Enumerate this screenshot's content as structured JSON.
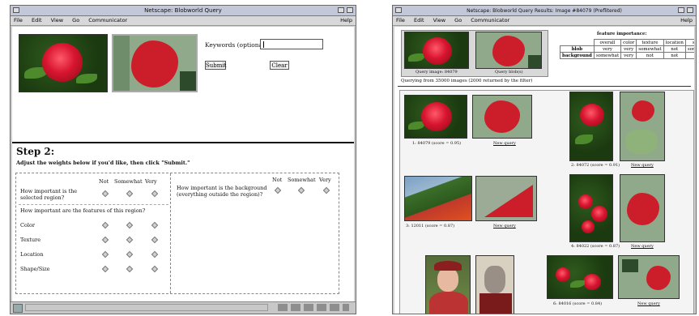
{
  "left_window": {
    "title": "Netscape: Blobworld Query",
    "menu": [
      "File",
      "Edit",
      "View",
      "Go",
      "Communicator"
    ],
    "help": "Help",
    "keywords_label": "Keywords (optional):",
    "keywords_value": "",
    "submit_label": "Submit",
    "clear_label": "Clear",
    "step_title": "Step 2:",
    "instructions": "Adjust the weights below if you'd like, then click \"Submit.\"",
    "col_not": "Not",
    "col_somewhat": "Somewhat",
    "col_very": "Very",
    "q_region_1": "How important is the",
    "q_region_2": "selected region?",
    "q_features": "How important are the features of this region?",
    "features": [
      "Color",
      "Texture",
      "Location",
      "Shape/Size"
    ],
    "q_background_1": "How important is the background",
    "q_background_2": "(everything outside the region)?"
  },
  "right_window": {
    "title": "Netscape: Blobworld Query Results: Image #84079 (Preflitered)",
    "menu": [
      "File",
      "Edit",
      "View",
      "Go",
      "Communicator"
    ],
    "help": "Help",
    "query_image_caption": "Query image: 84079",
    "query_blobs_caption": "Query blob(s)",
    "importance_header": "feature importance:",
    "importance_cols": [
      "overall",
      "color",
      "texture",
      "location",
      "shape"
    ],
    "importance_rows": [
      {
        "label": "blob",
        "values": [
          "very",
          "very",
          "somewhat",
          "not",
          "somewhat"
        ]
      },
      {
        "label": "background",
        "values": [
          "somewhat",
          "very",
          "not",
          "not",
          "not"
        ]
      }
    ],
    "querying_text": "Querying from 35000 images (2000 returned by the filter)",
    "new_query_label": "New query",
    "results": [
      {
        "caption": "1: 84079 (score = 0.95)"
      },
      {
        "caption": "2: 84072 (score = 0.91)"
      },
      {
        "caption": "3: 12011 (score = 0.87)"
      },
      {
        "caption": "4: 84022 (score = 0.87)"
      },
      {
        "caption": ""
      },
      {
        "caption": "6: 84016 (score = 0.84)"
      }
    ]
  }
}
